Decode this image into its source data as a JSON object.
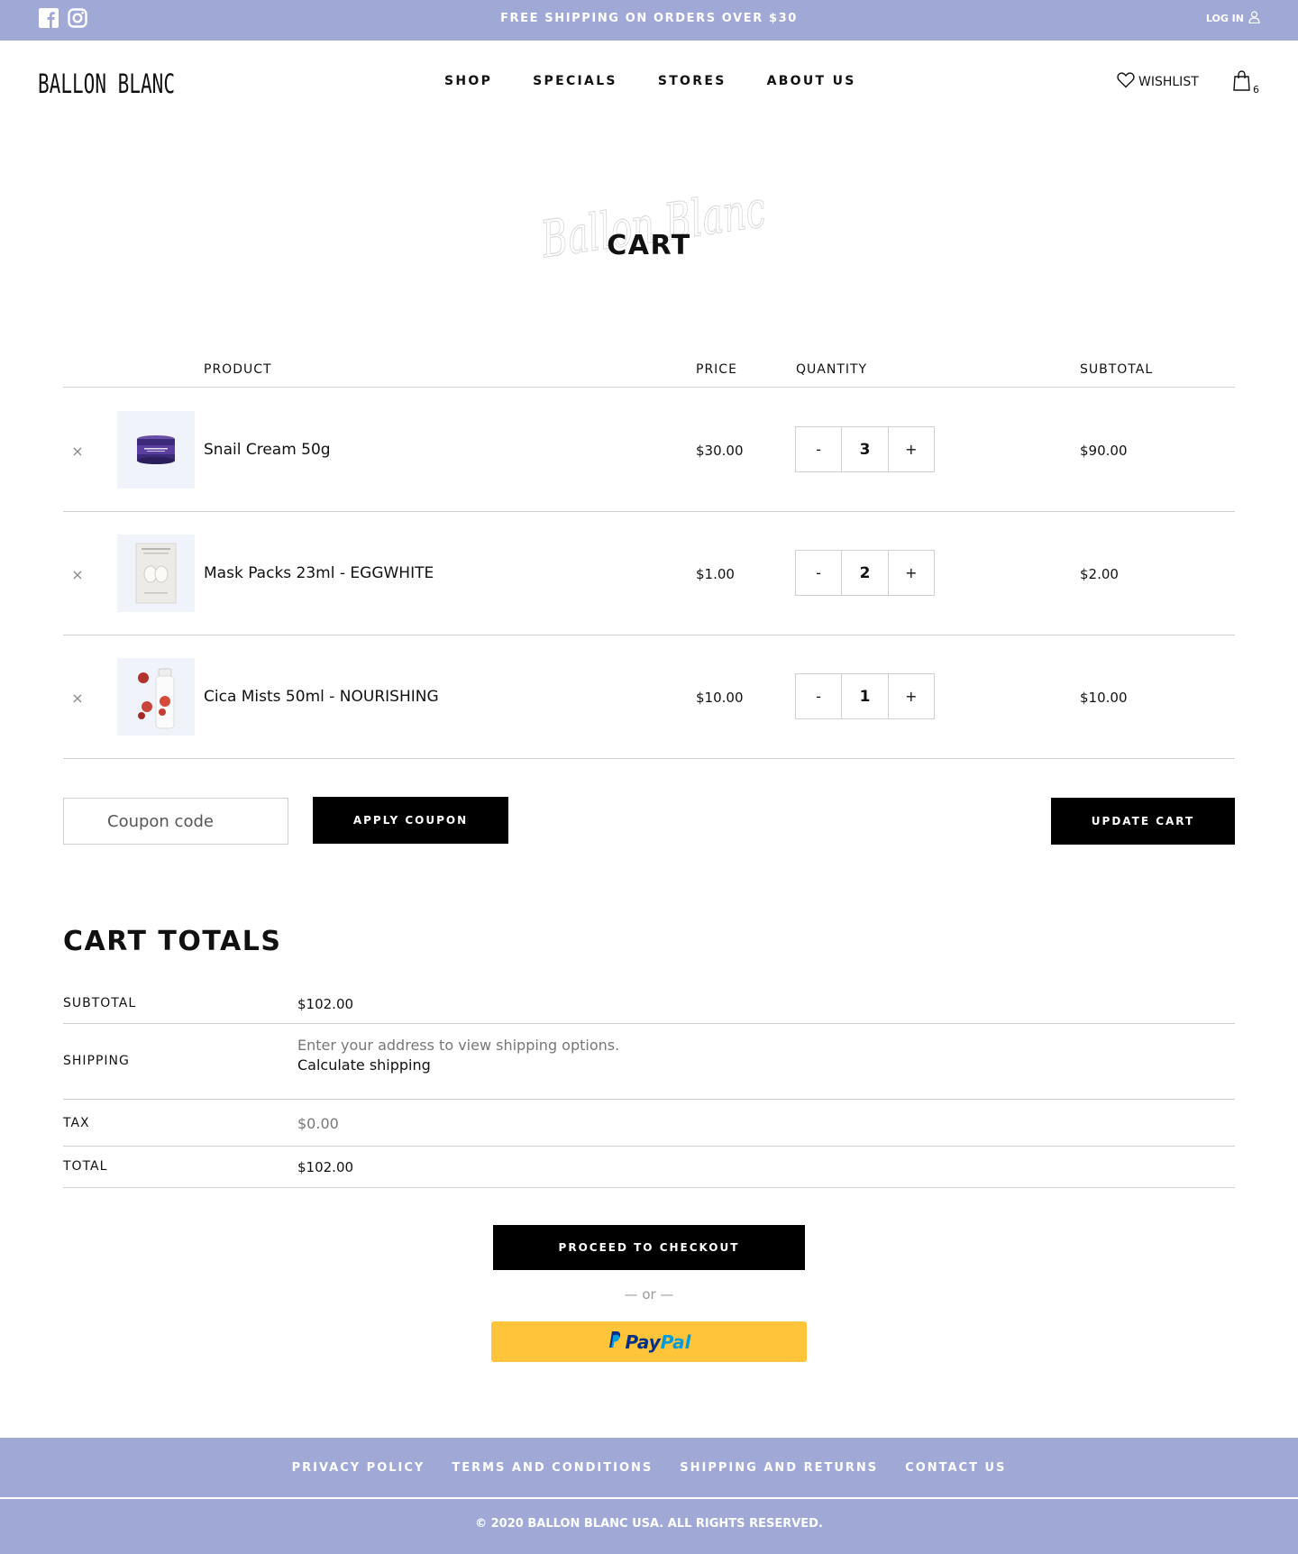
{
  "topbar": {
    "promo": "FREE SHIPPING ON ORDERS OVER $30",
    "login": "LOG IN",
    "icons": [
      "facebook-icon",
      "instagram-icon",
      "user-icon"
    ]
  },
  "header": {
    "logo": "BALLON BLANC",
    "nav": [
      "SHOP",
      "SPECIALS",
      "STORES",
      "ABOUT US"
    ],
    "wishlist": "WISHLIST",
    "cart_count": "6"
  },
  "page": {
    "script_watermark": "Ballon Blanc",
    "title": "CART"
  },
  "cart": {
    "columns": {
      "product": "PRODUCT",
      "price": "PRICE",
      "quantity": "QUANTITY",
      "subtotal": "SUBTOTAL"
    },
    "items": [
      {
        "remove": "×",
        "name": "Snail Cream 50g",
        "price": "$30.00",
        "minus": "-",
        "qty": "3",
        "plus": "+",
        "subtotal": "$90.00"
      },
      {
        "remove": "×",
        "name": "Mask Packs 23ml - EGGWHITE",
        "price": "$1.00",
        "minus": "-",
        "qty": "2",
        "plus": "+",
        "subtotal": "$2.00"
      },
      {
        "remove": "×",
        "name": "Cica Mists 50ml - NOURISHING",
        "price": "$10.00",
        "minus": "-",
        "qty": "1",
        "plus": "+",
        "subtotal": "$10.00"
      }
    ],
    "coupon_placeholder": "Coupon code",
    "apply_coupon": "APPLY COUPON",
    "update_cart": "UPDATE CART"
  },
  "totals": {
    "title": "CART TOTALS",
    "subtotal_label": "SUBTOTAL",
    "subtotal_value": "$102.00",
    "shipping_label": "SHIPPING",
    "shipping_note": "Enter your address to view shipping options.",
    "shipping_link": "Calculate shipping",
    "tax_label": "TAX",
    "tax_value": "$0.00",
    "total_label": "TOTAL",
    "total_value": "$102.00",
    "checkout": "PROCEED TO CHECKOUT",
    "or": "— or —",
    "paypal_a": "Pay",
    "paypal_b": "Pal"
  },
  "footer": {
    "links": [
      "PRIVACY POLICY",
      "TERMS AND CONDITIONS",
      "SHIPPING AND RETURNS",
      "CONTACT US"
    ],
    "copyright": "© 2020 BALLON BLANC USA. ALL RIGHTS RESERVED."
  },
  "colors": {
    "brand_lavender": "#a0a9d6",
    "paypal_yellow": "#ffc439",
    "black": "#000000"
  }
}
